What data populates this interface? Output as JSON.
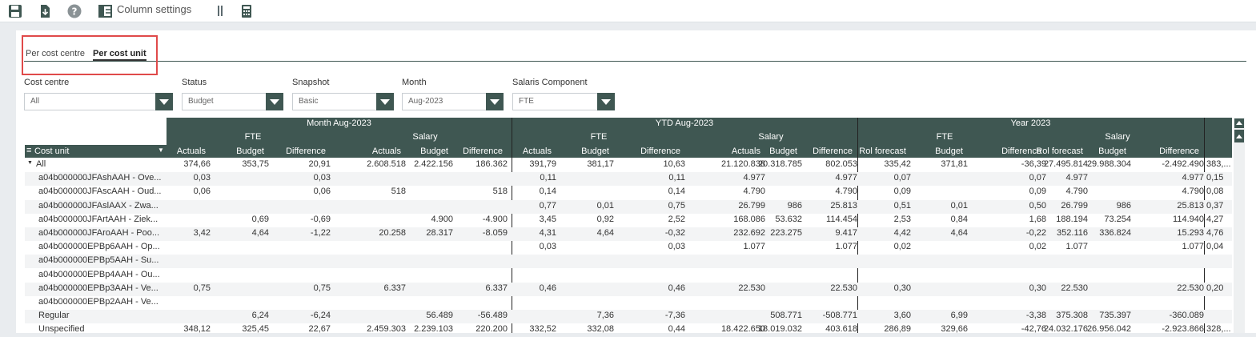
{
  "toolbar": {
    "column_settings_label": "Column settings",
    "icons": [
      "save-icon",
      "download-icon",
      "help-icon",
      "column-settings-icon",
      "pause-icon",
      "calculator-icon"
    ]
  },
  "tabs": [
    {
      "label": "Per cost centre",
      "active": false
    },
    {
      "label": "Per cost unit",
      "active": true
    }
  ],
  "filters": [
    {
      "label": "Cost centre",
      "value": "All"
    },
    {
      "label": "Status",
      "value": "Budget"
    },
    {
      "label": "Snapshot",
      "value": "Basic"
    },
    {
      "label": "Month",
      "value": "Aug-2023"
    },
    {
      "label": "Salaris Component",
      "value": "FTE"
    }
  ],
  "grid": {
    "row_header_label": "Cost unit",
    "groups": [
      {
        "title": "Month Aug-2023",
        "fte": "FTE",
        "salary": "Salary",
        "cols": [
          "Actuals",
          "Budget",
          "Difference",
          "Actuals",
          "Budget",
          "Difference"
        ]
      },
      {
        "title": "YTD Aug-2023",
        "fte": "FTE",
        "salary": "Salary",
        "cols": [
          "Actuals",
          "Budget",
          "Difference",
          "Actuals",
          "Budget",
          "Difference"
        ]
      },
      {
        "title": "Year 2023",
        "fte": "FTE",
        "salary": "Salary",
        "cols": [
          "Rol forecast",
          "Budget",
          "Difference",
          "Rol forecast",
          "Budget",
          "Difference"
        ]
      }
    ],
    "rows": [
      {
        "label": "All",
        "indent": false,
        "values": [
          "374,66",
          "353,75",
          "20,91",
          "2.608.518",
          "2.422.156",
          "186.362",
          "391,79",
          "381,17",
          "10,63",
          "21.120.838",
          "20.318.785",
          "802.053",
          "335,42",
          "371,81",
          "-36,39",
          "27.495.814",
          "29.988.304",
          "-2.492.490",
          "383,..."
        ]
      },
      {
        "label": "a04b000000JFAshAAH - Ove...",
        "indent": true,
        "values": [
          "0,03",
          "",
          "0,03",
          "",
          "",
          "",
          "0,11",
          "",
          "0,11",
          "4.977",
          "",
          "4.977",
          "0,07",
          "",
          "0,07",
          "4.977",
          "",
          "4.977",
          "0,15"
        ]
      },
      {
        "label": "a04b000000JFAscAAH - Oud...",
        "indent": true,
        "values": [
          "0,06",
          "",
          "0,06",
          "518",
          "",
          "518",
          "0,14",
          "",
          "0,14",
          "4.790",
          "",
          "4.790",
          "0,09",
          "",
          "0,09",
          "4.790",
          "",
          "4.790",
          "0,08"
        ]
      },
      {
        "label": "a04b000000JFAslAAX - Zwa...",
        "indent": true,
        "values": [
          "",
          "",
          "",
          "",
          "",
          "",
          "0,77",
          "0,01",
          "0,75",
          "26.799",
          "986",
          "25.813",
          "0,51",
          "0,01",
          "0,50",
          "26.799",
          "986",
          "25.813",
          "0,37"
        ]
      },
      {
        "label": "a04b000000JFArtAAH - Ziek...",
        "indent": true,
        "values": [
          "",
          "0,69",
          "-0,69",
          "",
          "4.900",
          "-4.900",
          "3,45",
          "0,92",
          "2,52",
          "168.086",
          "53.632",
          "114.454",
          "2,53",
          "0,84",
          "1,68",
          "188.194",
          "73.254",
          "114.940",
          "4,27"
        ]
      },
      {
        "label": "a04b000000JFAroAAH - Poo...",
        "indent": true,
        "values": [
          "3,42",
          "4,64",
          "-1,22",
          "20.258",
          "28.317",
          "-8.059",
          "4,31",
          "4,64",
          "-0,32",
          "232.692",
          "223.275",
          "9.417",
          "4,42",
          "4,64",
          "-0,22",
          "352.116",
          "336.824",
          "15.293",
          "4,76"
        ]
      },
      {
        "label": "a04b000000EPBp6AAH - Op...",
        "indent": true,
        "values": [
          "",
          "",
          "",
          "",
          "",
          "",
          "0,03",
          "",
          "0,03",
          "1.077",
          "",
          "1.077",
          "0,02",
          "",
          "0,02",
          "1.077",
          "",
          "1.077",
          "0,04"
        ]
      },
      {
        "label": "a04b000000EPBp5AAH - Su...",
        "indent": true,
        "values": [
          "",
          "",
          "",
          "",
          "",
          "",
          "",
          "",
          "",
          "",
          "",
          "",
          "",
          "",
          "",
          "",
          "",
          "",
          ""
        ]
      },
      {
        "label": "a04b000000EPBp4AAH - Ou...",
        "indent": true,
        "values": [
          "",
          "",
          "",
          "",
          "",
          "",
          "",
          "",
          "",
          "",
          "",
          "",
          "",
          "",
          "",
          "",
          "",
          "",
          ""
        ]
      },
      {
        "label": "a04b000000EPBp3AAH - Ve...",
        "indent": true,
        "values": [
          "0,75",
          "",
          "0,75",
          "6.337",
          "",
          "6.337",
          "0,46",
          "",
          "0,46",
          "22.530",
          "",
          "22.530",
          "0,30",
          "",
          "0,30",
          "22.530",
          "",
          "22.530",
          "0,20"
        ]
      },
      {
        "label": "a04b000000EPBp2AAH - Ve...",
        "indent": true,
        "values": [
          "",
          "",
          "",
          "",
          "",
          "",
          "",
          "",
          "",
          "",
          "",
          "",
          "",
          "",
          "",
          "",
          "",
          "",
          ""
        ]
      },
      {
        "label": "Regular",
        "indent": true,
        "values": [
          "",
          "6,24",
          "-6,24",
          "",
          "56.489",
          "-56.489",
          "",
          "7,36",
          "-7,36",
          "",
          "508.771",
          "-508.771",
          "3,60",
          "6,99",
          "-3,38",
          "375.308",
          "735.397",
          "-360.089",
          ""
        ]
      },
      {
        "label": "Unspecified",
        "indent": true,
        "values": [
          "348,12",
          "325,45",
          "22,67",
          "2.459.303",
          "2.239.103",
          "220.200",
          "332,52",
          "332,08",
          "0,44",
          "18.422.650",
          "18.019.032",
          "403.618",
          "286,89",
          "329,66",
          "-42,76",
          "24.032.176",
          "26.956.042",
          "-2.923.866",
          "328,..."
        ]
      }
    ]
  },
  "colors": {
    "header_bg": "#3f5752",
    "highlight": "#e04a4a"
  }
}
